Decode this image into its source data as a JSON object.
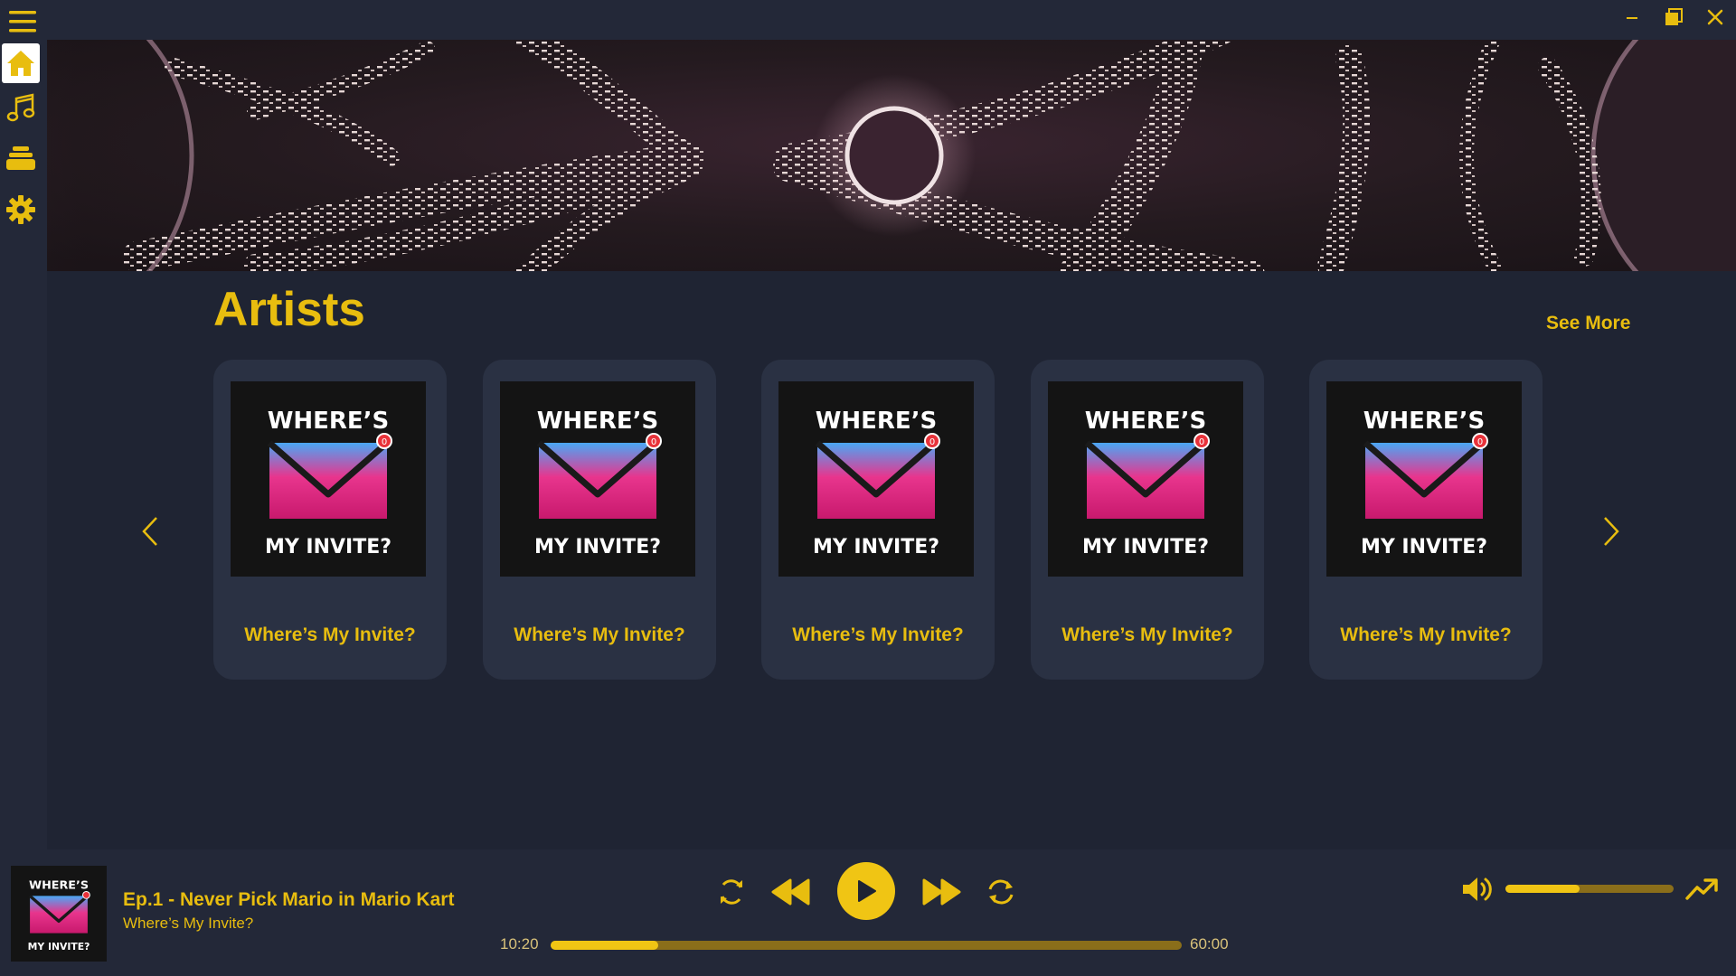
{
  "window": {
    "controls": [
      "minimize",
      "restore",
      "close"
    ]
  },
  "sidebar": {
    "items": [
      {
        "icon": "home-icon",
        "active": true
      },
      {
        "icon": "music-note-icon",
        "active": false
      },
      {
        "icon": "library-stack-icon",
        "active": false
      },
      {
        "icon": "gear-icon",
        "active": false
      }
    ]
  },
  "colors": {
    "accent": "#e8bd0f",
    "background": "#1f2433",
    "card": "#2a3143",
    "sidebar": "#232838"
  },
  "section": {
    "title": "Artists",
    "see_more": "See More"
  },
  "artists": [
    {
      "name": "Where’s My Invite?",
      "art_top": "WHERE’S",
      "art_bottom": "MY INVITE?",
      "badge": "0"
    },
    {
      "name": "Where’s My Invite?",
      "art_top": "WHERE’S",
      "art_bottom": "MY INVITE?",
      "badge": "0"
    },
    {
      "name": "Where’s My Invite?",
      "art_top": "WHERE’S",
      "art_bottom": "MY INVITE?",
      "badge": "0"
    },
    {
      "name": "Where’s My Invite?",
      "art_top": "WHERE’S",
      "art_bottom": "MY INVITE?",
      "badge": "0"
    },
    {
      "name": "Where’s My Invite?",
      "art_top": "WHERE’S",
      "art_bottom": "MY INVITE?",
      "badge": "0"
    }
  ],
  "player": {
    "art_top": "WHERE’S",
    "art_bottom": "MY INVITE?",
    "track_title": "Ep.1 - Never Pick Mario in Mario Kart",
    "track_artist": "Where’s My Invite?",
    "current_time": "10:20",
    "total_time": "60:00",
    "progress_fraction": 0.17,
    "volume_fraction": 0.44,
    "state": "paused"
  }
}
